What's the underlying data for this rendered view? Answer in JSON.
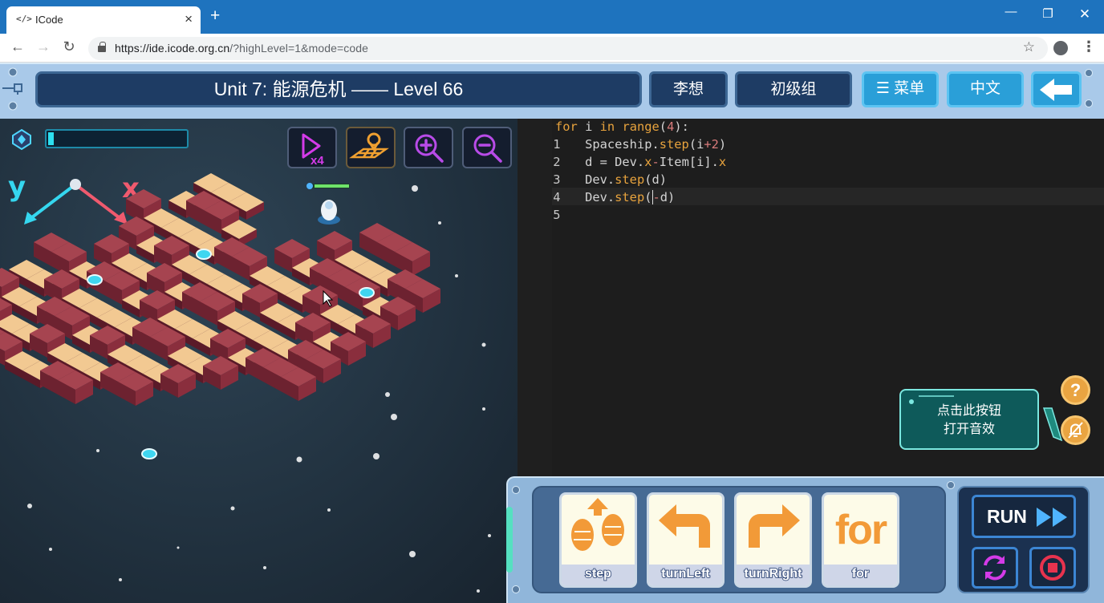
{
  "browser": {
    "tab_title": "ICode",
    "tab_favicon": "</>",
    "new_tab_label": "+",
    "url_host": "https://ide.icode.org.cn",
    "url_path": "/?highLevel=1&mode=code",
    "window_controls": [
      "minimize-icon",
      "restore-icon",
      "close-icon"
    ]
  },
  "header": {
    "title": "Unit 7: 能源危机 —— Level 66",
    "user_name": "李想",
    "group": "初级组",
    "menu_label": "菜单",
    "language": "中文"
  },
  "game": {
    "energy_progress": 0.04,
    "toolbar_icons": [
      "speed-x4-icon",
      "map-icon",
      "zoom-in-icon",
      "zoom-out-icon"
    ],
    "speed_label": "x4",
    "axis_y_label": "y",
    "axis_x_label": "x"
  },
  "editor": {
    "lines": [
      {
        "num": "1"
      },
      {
        "num": "2"
      },
      {
        "num": "3"
      },
      {
        "num": "4"
      },
      {
        "num": "5"
      }
    ],
    "tokens": {
      "l1": {
        "a": "for",
        "b": " i ",
        "c": "in",
        "d": " ",
        "e": "range",
        "f": "(",
        "g": "4",
        "h": "):"
      },
      "l2": {
        "a": "    Spaceship.",
        "b": "step",
        "c": "(i",
        "d": "+",
        "e": "2",
        "f": ")"
      },
      "l3": {
        "a": "    d = Dev.",
        "b": "x",
        "c": "-",
        "d": "Item[i].",
        "e": "x"
      },
      "l4": {
        "a": "    Dev.",
        "b": "step",
        "c": "(d)"
      },
      "l5": {
        "a": "    Dev.",
        "b": "step",
        "c": "(",
        "d": "-",
        "e": "d)"
      }
    }
  },
  "sound_tip": {
    "line1": "点击此按钮",
    "line2": "打开音效"
  },
  "help_label": "?",
  "blocks": [
    {
      "label": "step",
      "icon": "step-icon"
    },
    {
      "label": "turnLeft",
      "icon": "turn-left-icon"
    },
    {
      "label": "turnRight",
      "icon": "turn-right-icon"
    },
    {
      "label": "for",
      "icon": "for-icon"
    }
  ],
  "run": {
    "label": "RUN"
  },
  "colors": {
    "accent": "#2a9fd8",
    "header_dark": "#1e3c64",
    "editor_bg": "#1d1d1d",
    "keyword": "#e8a33d",
    "block_orange": "#f29a38",
    "floor": "#f0c78f",
    "wall": "#7f2b36"
  }
}
